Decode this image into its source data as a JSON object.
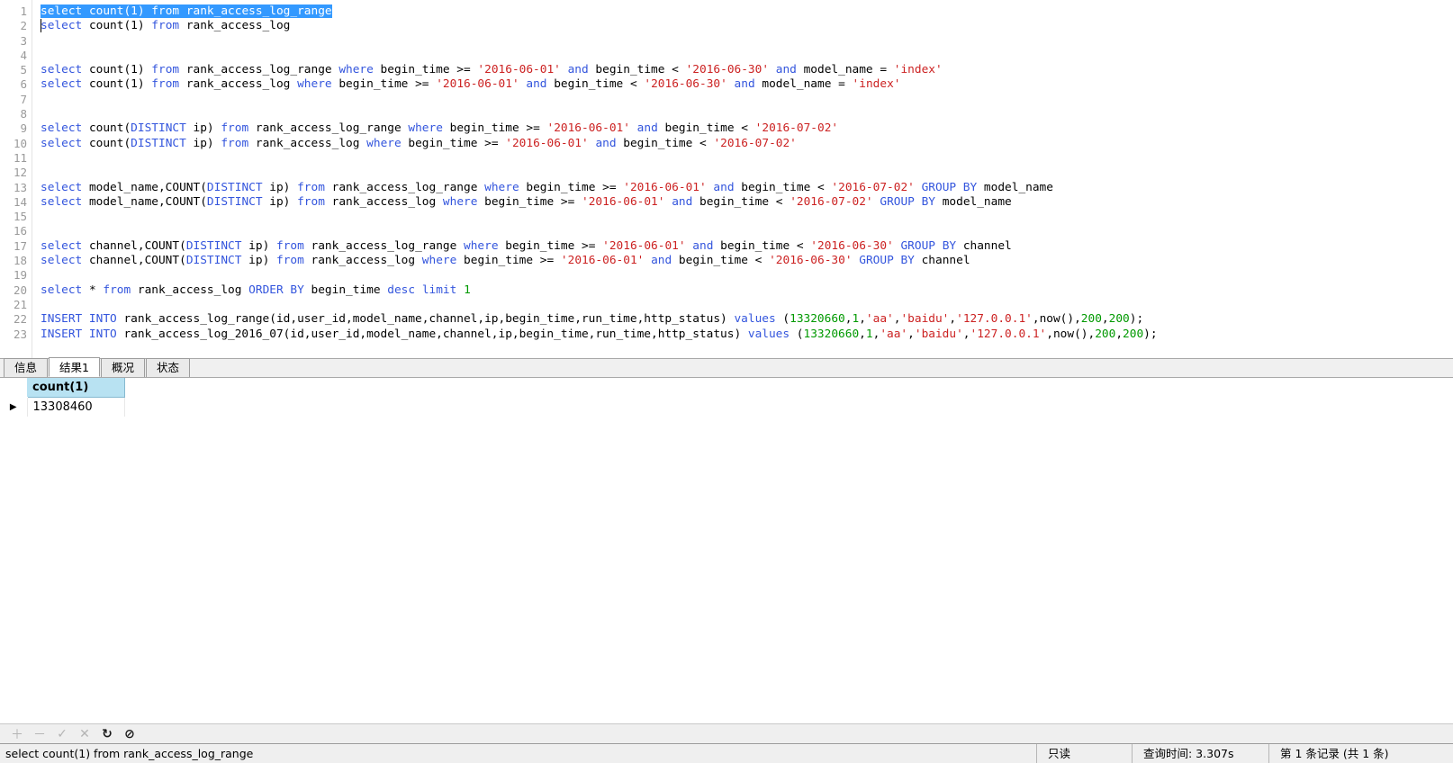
{
  "editor": {
    "selected_line": 1,
    "lines": [
      {
        "n": 1,
        "tokens": [
          {
            "t": "select",
            "c": "kw"
          },
          {
            "t": " count(1) ",
            "c": ""
          },
          {
            "t": "from",
            "c": "kw"
          },
          {
            "t": " rank_access_log_range",
            "c": ""
          }
        ],
        "selected": true
      },
      {
        "n": 2,
        "tokens": [
          {
            "t": "select",
            "c": "kw"
          },
          {
            "t": " count(1) ",
            "c": ""
          },
          {
            "t": "from",
            "c": "kw"
          },
          {
            "t": " rank_access_log",
            "c": ""
          }
        ]
      },
      {
        "n": 3,
        "tokens": []
      },
      {
        "n": 4,
        "tokens": []
      },
      {
        "n": 5,
        "tokens": [
          {
            "t": "select",
            "c": "kw"
          },
          {
            "t": " count(1) ",
            "c": ""
          },
          {
            "t": "from",
            "c": "kw"
          },
          {
            "t": " rank_access_log_range ",
            "c": ""
          },
          {
            "t": "where",
            "c": "kw"
          },
          {
            "t": " begin_time >= ",
            "c": ""
          },
          {
            "t": "'2016-06-01'",
            "c": "str"
          },
          {
            "t": " ",
            "c": ""
          },
          {
            "t": "and",
            "c": "kw"
          },
          {
            "t": " begin_time < ",
            "c": ""
          },
          {
            "t": "'2016-06-30'",
            "c": "str"
          },
          {
            "t": " ",
            "c": ""
          },
          {
            "t": "and",
            "c": "kw"
          },
          {
            "t": " model_name = ",
            "c": ""
          },
          {
            "t": "'index'",
            "c": "str"
          }
        ]
      },
      {
        "n": 6,
        "tokens": [
          {
            "t": "select",
            "c": "kw"
          },
          {
            "t": " count(1) ",
            "c": ""
          },
          {
            "t": "from",
            "c": "kw"
          },
          {
            "t": " rank_access_log ",
            "c": ""
          },
          {
            "t": "where",
            "c": "kw"
          },
          {
            "t": " begin_time >= ",
            "c": ""
          },
          {
            "t": "'2016-06-01'",
            "c": "str"
          },
          {
            "t": " ",
            "c": ""
          },
          {
            "t": "and",
            "c": "kw"
          },
          {
            "t": " begin_time < ",
            "c": ""
          },
          {
            "t": "'2016-06-30'",
            "c": "str"
          },
          {
            "t": " ",
            "c": ""
          },
          {
            "t": "and",
            "c": "kw"
          },
          {
            "t": " model_name = ",
            "c": ""
          },
          {
            "t": "'index'",
            "c": "str"
          }
        ]
      },
      {
        "n": 7,
        "tokens": []
      },
      {
        "n": 8,
        "tokens": []
      },
      {
        "n": 9,
        "tokens": [
          {
            "t": "select",
            "c": "kw"
          },
          {
            "t": " count(",
            "c": ""
          },
          {
            "t": "DISTINCT",
            "c": "kw"
          },
          {
            "t": " ip) ",
            "c": ""
          },
          {
            "t": "from",
            "c": "kw"
          },
          {
            "t": " rank_access_log_range ",
            "c": ""
          },
          {
            "t": "where",
            "c": "kw"
          },
          {
            "t": " begin_time >= ",
            "c": ""
          },
          {
            "t": "'2016-06-01'",
            "c": "str"
          },
          {
            "t": " ",
            "c": ""
          },
          {
            "t": "and",
            "c": "kw"
          },
          {
            "t": " begin_time < ",
            "c": ""
          },
          {
            "t": "'2016-07-02'",
            "c": "str"
          }
        ]
      },
      {
        "n": 10,
        "tokens": [
          {
            "t": "select",
            "c": "kw"
          },
          {
            "t": " count(",
            "c": ""
          },
          {
            "t": "DISTINCT",
            "c": "kw"
          },
          {
            "t": " ip) ",
            "c": ""
          },
          {
            "t": "from",
            "c": "kw"
          },
          {
            "t": " rank_access_log ",
            "c": ""
          },
          {
            "t": "where",
            "c": "kw"
          },
          {
            "t": " begin_time >= ",
            "c": ""
          },
          {
            "t": "'2016-06-01'",
            "c": "str"
          },
          {
            "t": " ",
            "c": ""
          },
          {
            "t": "and",
            "c": "kw"
          },
          {
            "t": " begin_time < ",
            "c": ""
          },
          {
            "t": "'2016-07-02'",
            "c": "str"
          }
        ]
      },
      {
        "n": 11,
        "tokens": []
      },
      {
        "n": 12,
        "tokens": []
      },
      {
        "n": 13,
        "tokens": [
          {
            "t": "select",
            "c": "kw"
          },
          {
            "t": " model_name,COUNT(",
            "c": ""
          },
          {
            "t": "DISTINCT",
            "c": "kw"
          },
          {
            "t": " ip) ",
            "c": ""
          },
          {
            "t": "from",
            "c": "kw"
          },
          {
            "t": " rank_access_log_range ",
            "c": ""
          },
          {
            "t": "where",
            "c": "kw"
          },
          {
            "t": " begin_time >= ",
            "c": ""
          },
          {
            "t": "'2016-06-01'",
            "c": "str"
          },
          {
            "t": " ",
            "c": ""
          },
          {
            "t": "and",
            "c": "kw"
          },
          {
            "t": " begin_time < ",
            "c": ""
          },
          {
            "t": "'2016-07-02'",
            "c": "str"
          },
          {
            "t": " ",
            "c": ""
          },
          {
            "t": "GROUP BY",
            "c": "kw"
          },
          {
            "t": " model_name",
            "c": ""
          }
        ]
      },
      {
        "n": 14,
        "tokens": [
          {
            "t": "select",
            "c": "kw"
          },
          {
            "t": " model_name,COUNT(",
            "c": ""
          },
          {
            "t": "DISTINCT",
            "c": "kw"
          },
          {
            "t": " ip) ",
            "c": ""
          },
          {
            "t": "from",
            "c": "kw"
          },
          {
            "t": " rank_access_log ",
            "c": ""
          },
          {
            "t": "where",
            "c": "kw"
          },
          {
            "t": " begin_time >= ",
            "c": ""
          },
          {
            "t": "'2016-06-01'",
            "c": "str"
          },
          {
            "t": " ",
            "c": ""
          },
          {
            "t": "and",
            "c": "kw"
          },
          {
            "t": " begin_time < ",
            "c": ""
          },
          {
            "t": "'2016-07-02'",
            "c": "str"
          },
          {
            "t": " ",
            "c": ""
          },
          {
            "t": "GROUP BY",
            "c": "kw"
          },
          {
            "t": " model_name",
            "c": ""
          }
        ]
      },
      {
        "n": 15,
        "tokens": []
      },
      {
        "n": 16,
        "tokens": []
      },
      {
        "n": 17,
        "tokens": [
          {
            "t": "select",
            "c": "kw"
          },
          {
            "t": " channel,COUNT(",
            "c": ""
          },
          {
            "t": "DISTINCT",
            "c": "kw"
          },
          {
            "t": " ip) ",
            "c": ""
          },
          {
            "t": "from",
            "c": "kw"
          },
          {
            "t": " rank_access_log_range ",
            "c": ""
          },
          {
            "t": "where",
            "c": "kw"
          },
          {
            "t": " begin_time >= ",
            "c": ""
          },
          {
            "t": "'2016-06-01'",
            "c": "str"
          },
          {
            "t": " ",
            "c": ""
          },
          {
            "t": "and",
            "c": "kw"
          },
          {
            "t": " begin_time < ",
            "c": ""
          },
          {
            "t": "'2016-06-30'",
            "c": "str"
          },
          {
            "t": " ",
            "c": ""
          },
          {
            "t": "GROUP BY",
            "c": "kw"
          },
          {
            "t": " channel",
            "c": ""
          }
        ]
      },
      {
        "n": 18,
        "tokens": [
          {
            "t": "select",
            "c": "kw"
          },
          {
            "t": " channel,COUNT(",
            "c": ""
          },
          {
            "t": "DISTINCT",
            "c": "kw"
          },
          {
            "t": " ip) ",
            "c": ""
          },
          {
            "t": "from",
            "c": "kw"
          },
          {
            "t": " rank_access_log ",
            "c": ""
          },
          {
            "t": "where",
            "c": "kw"
          },
          {
            "t": " begin_time >= ",
            "c": ""
          },
          {
            "t": "'2016-06-01'",
            "c": "str"
          },
          {
            "t": " ",
            "c": ""
          },
          {
            "t": "and",
            "c": "kw"
          },
          {
            "t": " begin_time < ",
            "c": ""
          },
          {
            "t": "'2016-06-30'",
            "c": "str"
          },
          {
            "t": " ",
            "c": ""
          },
          {
            "t": "GROUP BY",
            "c": "kw"
          },
          {
            "t": " channel",
            "c": ""
          }
        ]
      },
      {
        "n": 19,
        "tokens": []
      },
      {
        "n": 20,
        "tokens": [
          {
            "t": "select",
            "c": "kw"
          },
          {
            "t": " * ",
            "c": ""
          },
          {
            "t": "from",
            "c": "kw"
          },
          {
            "t": " rank_access_log ",
            "c": ""
          },
          {
            "t": "ORDER BY",
            "c": "kw"
          },
          {
            "t": " begin_time ",
            "c": ""
          },
          {
            "t": "desc",
            "c": "kw"
          },
          {
            "t": " ",
            "c": ""
          },
          {
            "t": "limit",
            "c": "kw"
          },
          {
            "t": " ",
            "c": ""
          },
          {
            "t": "1",
            "c": "num"
          }
        ]
      },
      {
        "n": 21,
        "tokens": []
      },
      {
        "n": 22,
        "tokens": [
          {
            "t": "INSERT INTO",
            "c": "kw"
          },
          {
            "t": " rank_access_log_range(id,user_id,model_name,channel,ip,begin_time,run_time,http_status) ",
            "c": ""
          },
          {
            "t": "values",
            "c": "kw"
          },
          {
            "t": " (",
            "c": ""
          },
          {
            "t": "13320660",
            "c": "num"
          },
          {
            "t": ",",
            "c": ""
          },
          {
            "t": "1",
            "c": "num"
          },
          {
            "t": ",",
            "c": ""
          },
          {
            "t": "'aa'",
            "c": "str"
          },
          {
            "t": ",",
            "c": ""
          },
          {
            "t": "'baidu'",
            "c": "str"
          },
          {
            "t": ",",
            "c": ""
          },
          {
            "t": "'127.0.0.1'",
            "c": "str"
          },
          {
            "t": ",now(),",
            "c": ""
          },
          {
            "t": "200",
            "c": "num"
          },
          {
            "t": ",",
            "c": ""
          },
          {
            "t": "200",
            "c": "num"
          },
          {
            "t": ");",
            "c": ""
          }
        ]
      },
      {
        "n": 23,
        "tokens": [
          {
            "t": "INSERT INTO",
            "c": "kw"
          },
          {
            "t": " rank_access_log_2016_07(id,user_id,model_name,channel,ip,begin_time,run_time,http_status) ",
            "c": ""
          },
          {
            "t": "values",
            "c": "kw"
          },
          {
            "t": " (",
            "c": ""
          },
          {
            "t": "13320660",
            "c": "num"
          },
          {
            "t": ",",
            "c": ""
          },
          {
            "t": "1",
            "c": "num"
          },
          {
            "t": ",",
            "c": ""
          },
          {
            "t": "'aa'",
            "c": "str"
          },
          {
            "t": ",",
            "c": ""
          },
          {
            "t": "'baidu'",
            "c": "str"
          },
          {
            "t": ",",
            "c": ""
          },
          {
            "t": "'127.0.0.1'",
            "c": "str"
          },
          {
            "t": ",now(),",
            "c": ""
          },
          {
            "t": "200",
            "c": "num"
          },
          {
            "t": ",",
            "c": ""
          },
          {
            "t": "200",
            "c": "num"
          },
          {
            "t": ");",
            "c": ""
          }
        ]
      }
    ]
  },
  "tabs": [
    {
      "label": "信息",
      "active": false
    },
    {
      "label": "结果1",
      "active": true
    },
    {
      "label": "概况",
      "active": false
    },
    {
      "label": "状态",
      "active": false
    }
  ],
  "result": {
    "columns": [
      "count(1)"
    ],
    "rows": [
      {
        "marker": "▶",
        "cells": [
          "13308460"
        ]
      }
    ]
  },
  "toolbar": {
    "buttons": [
      {
        "name": "add-record-button",
        "glyph": "＋",
        "enabled": false
      },
      {
        "name": "remove-record-button",
        "glyph": "－",
        "enabled": false
      },
      {
        "name": "apply-changes-button",
        "glyph": "✓",
        "enabled": false
      },
      {
        "name": "cancel-changes-button",
        "glyph": "✕",
        "enabled": false
      },
      {
        "name": "refresh-button",
        "glyph": "↻",
        "enabled": true
      },
      {
        "name": "stop-button",
        "glyph": "⊘",
        "enabled": true
      }
    ]
  },
  "statusbar": {
    "query": "select count(1) from rank_access_log_range",
    "readonly": "只读",
    "query_time": "查询时间: 3.307s",
    "record_info": "第 1 条记录 (共 1 条)"
  },
  "colors": {
    "keyword": "#3355dd",
    "string": "#cc2222",
    "number": "#009900",
    "selection": "#3399ff",
    "header": "#b8e2f2"
  }
}
